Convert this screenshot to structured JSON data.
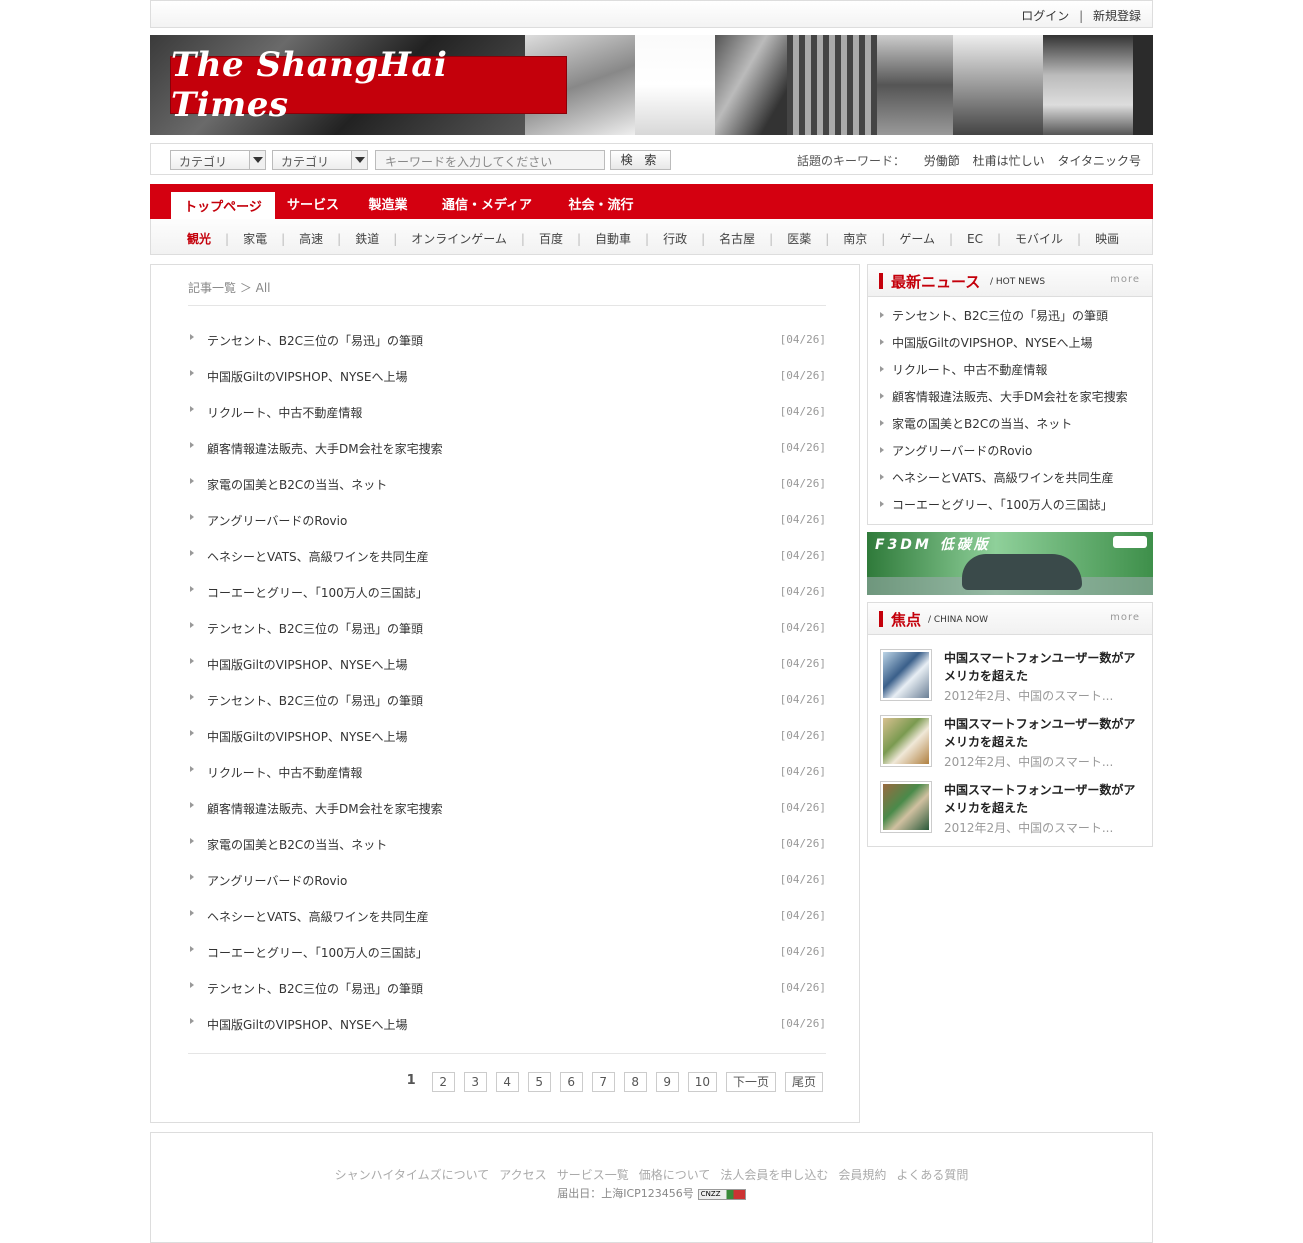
{
  "topbar": {
    "login": "ログイン",
    "separator": "|",
    "register": "新規登録"
  },
  "banner": {
    "logo_text": "The ShangHai Times"
  },
  "search": {
    "category1": "カテゴリ",
    "category2": "カテゴリ",
    "keyword_placeholder": "キーワードを入力してください",
    "button": "検 索",
    "hot_label": "話題のキーワード：",
    "hot_keywords": [
      "労働節",
      "杜甫は忙しい",
      "タイタニック号"
    ]
  },
  "nav": {
    "tabs": [
      "トップページ",
      "サービス",
      "製造業",
      "通信・メディア",
      "社会・流行"
    ],
    "active": "トップページ"
  },
  "subnav": {
    "items": [
      "観光",
      "家電",
      "高速",
      "鉄道",
      "オンラインゲーム",
      "百度",
      "自動車",
      "行政",
      "名古屋",
      "医薬",
      "南京",
      "ゲーム",
      "EC",
      "モバイル",
      "映画"
    ],
    "separator": "|"
  },
  "main": {
    "breadcrumb": "記事一覧 ＞ All",
    "articles": [
      {
        "title": "テンセント、B2C三位の「易迅」の筆頭",
        "date": "[04/26]"
      },
      {
        "title": "中国版GiltのVIPSHOP、NYSEへ上場",
        "date": "[04/26]"
      },
      {
        "title": "リクルート、中古不動産情報",
        "date": "[04/26]"
      },
      {
        "title": "顧客情報違法販売、大手DM会社を家宅捜索",
        "date": "[04/26]"
      },
      {
        "title": "家電の国美とB2Cの当当、ネット",
        "date": "[04/26]"
      },
      {
        "title": "アングリーバードのRovio",
        "date": "[04/26]"
      },
      {
        "title": "ヘネシーとVATS、高級ワインを共同生産",
        "date": "[04/26]"
      },
      {
        "title": "コーエーとグリー、「100万人の三国誌」",
        "date": "[04/26]"
      },
      {
        "title": "テンセント、B2C三位の「易迅」の筆頭",
        "date": "[04/26]"
      },
      {
        "title": "中国版GiltのVIPSHOP、NYSEへ上場",
        "date": "[04/26]"
      },
      {
        "title": "テンセント、B2C三位の「易迅」の筆頭",
        "date": "[04/26]"
      },
      {
        "title": "中国版GiltのVIPSHOP、NYSEへ上場",
        "date": "[04/26]"
      },
      {
        "title": "リクルート、中古不動産情報",
        "date": "[04/26]"
      },
      {
        "title": "顧客情報違法販売、大手DM会社を家宅捜索",
        "date": "[04/26]"
      },
      {
        "title": "家電の国美とB2Cの当当、ネット",
        "date": "[04/26]"
      },
      {
        "title": "アングリーバードのRovio",
        "date": "[04/26]"
      },
      {
        "title": "ヘネシーとVATS、高級ワインを共同生産",
        "date": "[04/26]"
      },
      {
        "title": "コーエーとグリー、「100万人の三国誌」",
        "date": "[04/26]"
      },
      {
        "title": "テンセント、B2C三位の「易迅」の筆頭",
        "date": "[04/26]"
      },
      {
        "title": "中国版GiltのVIPSHOP、NYSEへ上場",
        "date": "[04/26]"
      }
    ],
    "pager": {
      "current": "1",
      "pages": [
        "2",
        "3",
        "4",
        "5",
        "6",
        "7",
        "8",
        "9",
        "10"
      ],
      "next": "下一页",
      "last": "尾页"
    }
  },
  "sidebar": {
    "latest": {
      "title": "最新ニュース",
      "subtitle": "/ HOT NEWS",
      "more": "more",
      "items": [
        "テンセント、B2C三位の「易迅」の筆頭",
        "中国版GiltのVIPSHOP、NYSEへ上場",
        "リクルート、中古不動産情報",
        "顧客情報違法販売、大手DM会社を家宅捜索",
        "家電の国美とB2Cの当当、ネット",
        "アングリーバードのRovio",
        "ヘネシーとVATS、高級ワインを共同生産",
        "コーエーとグリー、「100万人の三国誌」"
      ]
    },
    "ad": {
      "text": "F3DM 低碳版"
    },
    "focus": {
      "title": "焦点",
      "subtitle": "/ CHINA NOW",
      "more": "more",
      "items": [
        {
          "headline": "中国スマートフォンユーザー数がアメリカを超えた",
          "summary": "2012年2月、中国のスマート..."
        },
        {
          "headline": "中国スマートフォンユーザー数がアメリカを超えた",
          "summary": "2012年2月、中国のスマート..."
        },
        {
          "headline": "中国スマートフォンユーザー数がアメリカを超えた",
          "summary": "2012年2月、中国のスマート..."
        }
      ]
    }
  },
  "footer": {
    "links": [
      "シャンハイタイムズについて",
      "アクセス",
      "サービス一覧",
      "価格について",
      "法人会員を申し込む",
      "会員規約",
      "よくある質問"
    ],
    "icp": "届出日：上海ICP123456号",
    "badge": "CNZZ"
  }
}
